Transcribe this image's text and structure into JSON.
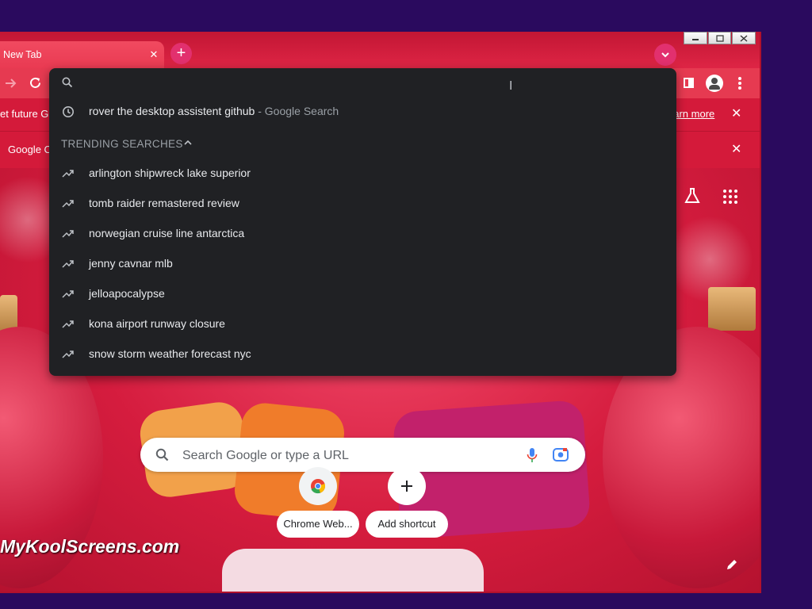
{
  "tab": {
    "title": "New Tab",
    "close": "✕"
  },
  "newtab": {
    "label": "+"
  },
  "infobars": [
    {
      "text": "et future G",
      "link": "earn more",
      "close": "✕"
    },
    {
      "text": "Google C",
      "close": "✕"
    }
  ],
  "omnibox": {
    "placeholder": "",
    "history": [
      {
        "query": "rover the desktop assistent github",
        "suffix": " - Google Search"
      }
    ],
    "trending_header": "TRENDING SEARCHES",
    "trending": [
      "arlington shipwreck lake superior",
      "tomb raider remastered review",
      "norwegian cruise line antarctica",
      "jenny cavnar mlb",
      "jelloapocalypse",
      "kona airport runway closure",
      "snow storm weather forecast nyc"
    ]
  },
  "realbox": {
    "placeholder": "Search Google or type a URL"
  },
  "shortcuts": [
    {
      "label": "Chrome Web..."
    },
    {
      "label": "Add shortcut"
    }
  ],
  "watermark": "MyKoolScreens.com",
  "colors": {
    "frame": "#d81b3c",
    "omnibox_bg": "#202124",
    "desktop": "#2a0a5e"
  }
}
